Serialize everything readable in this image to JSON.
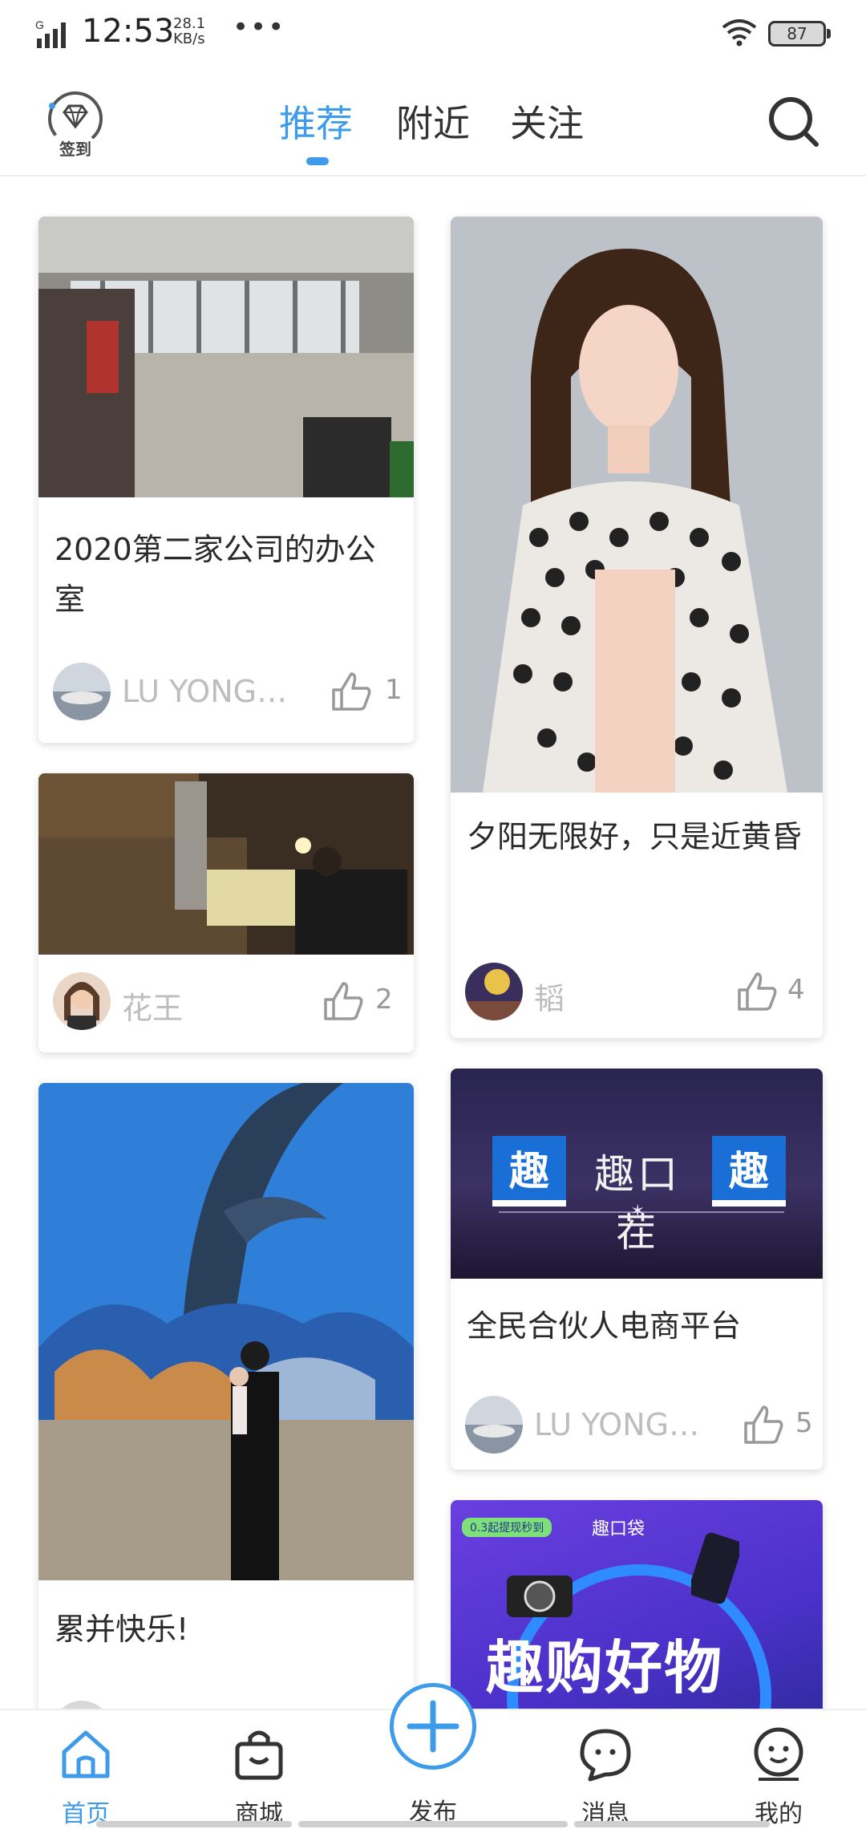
{
  "status_bar": {
    "network": "G",
    "time": "12:53",
    "speed_value": "28.1",
    "speed_unit": "KB/s",
    "more": "•••",
    "battery": "87"
  },
  "top_nav": {
    "checkin_label": "签到",
    "tabs": [
      {
        "label": "推荐",
        "active": true
      },
      {
        "label": "附近",
        "active": false
      },
      {
        "label": "关注",
        "active": false
      }
    ],
    "accent_color": "#3d9be9"
  },
  "feed": {
    "cards": [
      {
        "title": "2020第二家公司的办公室",
        "author": "LU YONG…",
        "likes": "1"
      },
      {
        "title": "",
        "author": "花王",
        "likes": "2"
      },
      {
        "title": "累并快乐!",
        "author": "",
        "likes": ""
      },
      {
        "title": "夕阳无限好，只是近黄昏",
        "author": "韬",
        "likes": "4"
      },
      {
        "title": "全民合伙人电商平台",
        "author": "LU YONG…",
        "likes": "5",
        "banner_text": "趣口茬",
        "banner_badge": "趣"
      },
      {
        "title": "",
        "author": "",
        "likes": "",
        "promo_brand": "趣口袋",
        "promo_tag": "0.3起提现秒到",
        "promo_headline": "趣购好物"
      }
    ]
  },
  "bottom_nav": {
    "items": [
      {
        "label": "首页",
        "icon": "home-icon",
        "active": true
      },
      {
        "label": "商城",
        "icon": "shop-bag-icon",
        "active": false
      },
      {
        "label": "发布",
        "icon": "plus-icon",
        "active": false
      },
      {
        "label": "消息",
        "icon": "message-icon",
        "active": false
      },
      {
        "label": "我的",
        "icon": "profile-icon",
        "active": false
      }
    ]
  }
}
